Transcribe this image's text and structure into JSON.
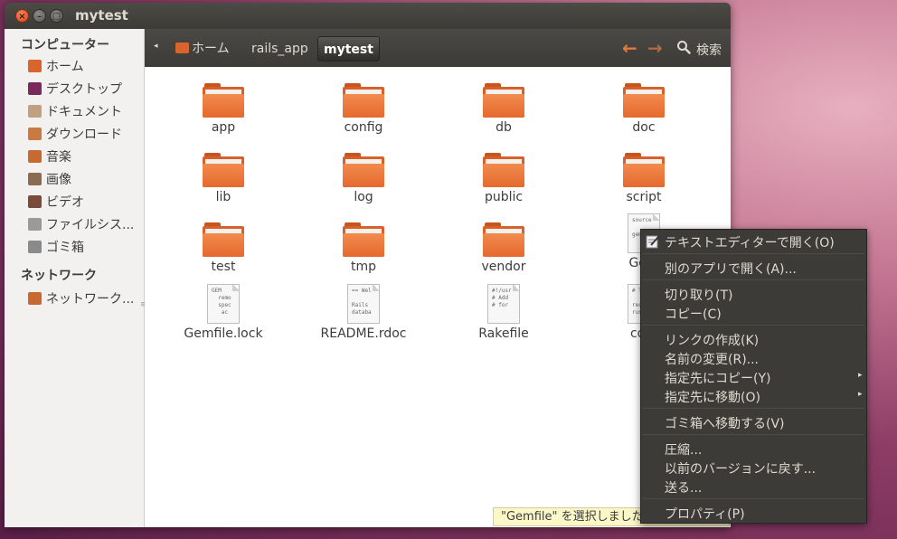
{
  "window": {
    "title": "mytest"
  },
  "sidebar": {
    "computer_heading": "コンピューター",
    "computer_items": [
      {
        "label": "ホーム",
        "icon": "home-folder-icon",
        "color": "#d9642c"
      },
      {
        "label": "デスクトップ",
        "icon": "desktop-icon",
        "color": "#7a2a5a"
      },
      {
        "label": "ドキュメント",
        "icon": "documents-icon",
        "color": "#c0a080"
      },
      {
        "label": "ダウンロード",
        "icon": "downloads-icon",
        "color": "#c87a40"
      },
      {
        "label": "音楽",
        "icon": "music-icon",
        "color": "#c86a30"
      },
      {
        "label": "画像",
        "icon": "pictures-icon",
        "color": "#8a6a50"
      },
      {
        "label": "ビデオ",
        "icon": "videos-icon",
        "color": "#7a4a3a"
      },
      {
        "label": "ファイルシス...",
        "icon": "filesystem-icon",
        "color": "#9a9a9a"
      },
      {
        "label": "ゴミ箱",
        "icon": "trash-icon",
        "color": "#8a8a8a"
      }
    ],
    "network_heading": "ネットワーク",
    "network_items": [
      {
        "label": "ネットワーク...",
        "icon": "network-icon",
        "color": "#c86a30"
      }
    ]
  },
  "toolbar": {
    "crumbs": [
      "ホーム",
      "rails_app",
      "mytest"
    ],
    "back_arrow": "←",
    "forward_arrow": "→",
    "search_label": "検索"
  },
  "files": [
    {
      "name": "app",
      "type": "folder"
    },
    {
      "name": "config",
      "type": "folder"
    },
    {
      "name": "db",
      "type": "folder"
    },
    {
      "name": "doc",
      "type": "folder"
    },
    {
      "name": "lib",
      "type": "folder"
    },
    {
      "name": "log",
      "type": "folder"
    },
    {
      "name": "public",
      "type": "folder"
    },
    {
      "name": "script",
      "type": "folder"
    },
    {
      "name": "test",
      "type": "folder"
    },
    {
      "name": "tmp",
      "type": "folder"
    },
    {
      "name": "vendor",
      "type": "folder"
    },
    {
      "name": "Gem",
      "type": "file",
      "preview": "source\n\ngem"
    },
    {
      "name": "Gemfile.lock",
      "type": "file",
      "preview": "GEM\n  remo\n  spec\n   ac"
    },
    {
      "name": "README.rdoc",
      "type": "file",
      "preview": "== Wel\n\nRails\ndataba"
    },
    {
      "name": "Rakefile",
      "type": "file",
      "preview": "#!/usr\n# Add\n# for"
    },
    {
      "name": "conf",
      "type": "file",
      "preview": "# Th\n\nrequ\nrun"
    }
  ],
  "context_menu": {
    "items": [
      "テキストエディターで開く(O)",
      "別のアプリで開く(A)...",
      "切り取り(T)",
      "コピー(C)",
      "リンクの作成(K)",
      "名前の変更(R)...",
      "指定先にコピー(Y)",
      "指定先に移動(O)",
      "ゴミ箱へ移動する(V)",
      "圧縮...",
      "以前のバージョンに戻す...",
      "送る...",
      "プロパティ(P)"
    ],
    "submenu_arrow": "▸"
  },
  "status": {
    "tooltip": "\"Gemfile\" を選択しました"
  },
  "colors": {
    "accent": "#e27a3f",
    "folder": "#e5692d",
    "menu_bg": "#3c3b37"
  }
}
